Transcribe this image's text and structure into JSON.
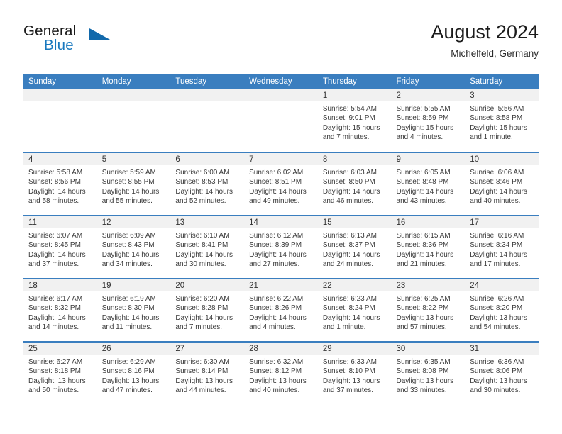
{
  "brand": {
    "name_part1": "General",
    "name_part2": "Blue",
    "logo_icon": "triangle-logo-icon",
    "accent_color": "#1878be",
    "triangle_color": "#1269ab"
  },
  "header": {
    "title": "August 2024",
    "subtitle": "Michelfeld, Germany"
  },
  "calendar": {
    "header_bg": "#3a7ebf",
    "daynum_bg": "#f1f1f1",
    "weekdays": [
      "Sunday",
      "Monday",
      "Tuesday",
      "Wednesday",
      "Thursday",
      "Friday",
      "Saturday"
    ],
    "weeks": [
      [
        {
          "day": "",
          "lines": []
        },
        {
          "day": "",
          "lines": []
        },
        {
          "day": "",
          "lines": []
        },
        {
          "day": "",
          "lines": []
        },
        {
          "day": "1",
          "lines": [
            "Sunrise: 5:54 AM",
            "Sunset: 9:01 PM",
            "Daylight: 15 hours",
            "and 7 minutes."
          ]
        },
        {
          "day": "2",
          "lines": [
            "Sunrise: 5:55 AM",
            "Sunset: 8:59 PM",
            "Daylight: 15 hours",
            "and 4 minutes."
          ]
        },
        {
          "day": "3",
          "lines": [
            "Sunrise: 5:56 AM",
            "Sunset: 8:58 PM",
            "Daylight: 15 hours",
            "and 1 minute."
          ]
        }
      ],
      [
        {
          "day": "4",
          "lines": [
            "Sunrise: 5:58 AM",
            "Sunset: 8:56 PM",
            "Daylight: 14 hours",
            "and 58 minutes."
          ]
        },
        {
          "day": "5",
          "lines": [
            "Sunrise: 5:59 AM",
            "Sunset: 8:55 PM",
            "Daylight: 14 hours",
            "and 55 minutes."
          ]
        },
        {
          "day": "6",
          "lines": [
            "Sunrise: 6:00 AM",
            "Sunset: 8:53 PM",
            "Daylight: 14 hours",
            "and 52 minutes."
          ]
        },
        {
          "day": "7",
          "lines": [
            "Sunrise: 6:02 AM",
            "Sunset: 8:51 PM",
            "Daylight: 14 hours",
            "and 49 minutes."
          ]
        },
        {
          "day": "8",
          "lines": [
            "Sunrise: 6:03 AM",
            "Sunset: 8:50 PM",
            "Daylight: 14 hours",
            "and 46 minutes."
          ]
        },
        {
          "day": "9",
          "lines": [
            "Sunrise: 6:05 AM",
            "Sunset: 8:48 PM",
            "Daylight: 14 hours",
            "and 43 minutes."
          ]
        },
        {
          "day": "10",
          "lines": [
            "Sunrise: 6:06 AM",
            "Sunset: 8:46 PM",
            "Daylight: 14 hours",
            "and 40 minutes."
          ]
        }
      ],
      [
        {
          "day": "11",
          "lines": [
            "Sunrise: 6:07 AM",
            "Sunset: 8:45 PM",
            "Daylight: 14 hours",
            "and 37 minutes."
          ]
        },
        {
          "day": "12",
          "lines": [
            "Sunrise: 6:09 AM",
            "Sunset: 8:43 PM",
            "Daylight: 14 hours",
            "and 34 minutes."
          ]
        },
        {
          "day": "13",
          "lines": [
            "Sunrise: 6:10 AM",
            "Sunset: 8:41 PM",
            "Daylight: 14 hours",
            "and 30 minutes."
          ]
        },
        {
          "day": "14",
          "lines": [
            "Sunrise: 6:12 AM",
            "Sunset: 8:39 PM",
            "Daylight: 14 hours",
            "and 27 minutes."
          ]
        },
        {
          "day": "15",
          "lines": [
            "Sunrise: 6:13 AM",
            "Sunset: 8:37 PM",
            "Daylight: 14 hours",
            "and 24 minutes."
          ]
        },
        {
          "day": "16",
          "lines": [
            "Sunrise: 6:15 AM",
            "Sunset: 8:36 PM",
            "Daylight: 14 hours",
            "and 21 minutes."
          ]
        },
        {
          "day": "17",
          "lines": [
            "Sunrise: 6:16 AM",
            "Sunset: 8:34 PM",
            "Daylight: 14 hours",
            "and 17 minutes."
          ]
        }
      ],
      [
        {
          "day": "18",
          "lines": [
            "Sunrise: 6:17 AM",
            "Sunset: 8:32 PM",
            "Daylight: 14 hours",
            "and 14 minutes."
          ]
        },
        {
          "day": "19",
          "lines": [
            "Sunrise: 6:19 AM",
            "Sunset: 8:30 PM",
            "Daylight: 14 hours",
            "and 11 minutes."
          ]
        },
        {
          "day": "20",
          "lines": [
            "Sunrise: 6:20 AM",
            "Sunset: 8:28 PM",
            "Daylight: 14 hours",
            "and 7 minutes."
          ]
        },
        {
          "day": "21",
          "lines": [
            "Sunrise: 6:22 AM",
            "Sunset: 8:26 PM",
            "Daylight: 14 hours",
            "and 4 minutes."
          ]
        },
        {
          "day": "22",
          "lines": [
            "Sunrise: 6:23 AM",
            "Sunset: 8:24 PM",
            "Daylight: 14 hours",
            "and 1 minute."
          ]
        },
        {
          "day": "23",
          "lines": [
            "Sunrise: 6:25 AM",
            "Sunset: 8:22 PM",
            "Daylight: 13 hours",
            "and 57 minutes."
          ]
        },
        {
          "day": "24",
          "lines": [
            "Sunrise: 6:26 AM",
            "Sunset: 8:20 PM",
            "Daylight: 13 hours",
            "and 54 minutes."
          ]
        }
      ],
      [
        {
          "day": "25",
          "lines": [
            "Sunrise: 6:27 AM",
            "Sunset: 8:18 PM",
            "Daylight: 13 hours",
            "and 50 minutes."
          ]
        },
        {
          "day": "26",
          "lines": [
            "Sunrise: 6:29 AM",
            "Sunset: 8:16 PM",
            "Daylight: 13 hours",
            "and 47 minutes."
          ]
        },
        {
          "day": "27",
          "lines": [
            "Sunrise: 6:30 AM",
            "Sunset: 8:14 PM",
            "Daylight: 13 hours",
            "and 44 minutes."
          ]
        },
        {
          "day": "28",
          "lines": [
            "Sunrise: 6:32 AM",
            "Sunset: 8:12 PM",
            "Daylight: 13 hours",
            "and 40 minutes."
          ]
        },
        {
          "day": "29",
          "lines": [
            "Sunrise: 6:33 AM",
            "Sunset: 8:10 PM",
            "Daylight: 13 hours",
            "and 37 minutes."
          ]
        },
        {
          "day": "30",
          "lines": [
            "Sunrise: 6:35 AM",
            "Sunset: 8:08 PM",
            "Daylight: 13 hours",
            "and 33 minutes."
          ]
        },
        {
          "day": "31",
          "lines": [
            "Sunrise: 6:36 AM",
            "Sunset: 8:06 PM",
            "Daylight: 13 hours",
            "and 30 minutes."
          ]
        }
      ]
    ]
  }
}
